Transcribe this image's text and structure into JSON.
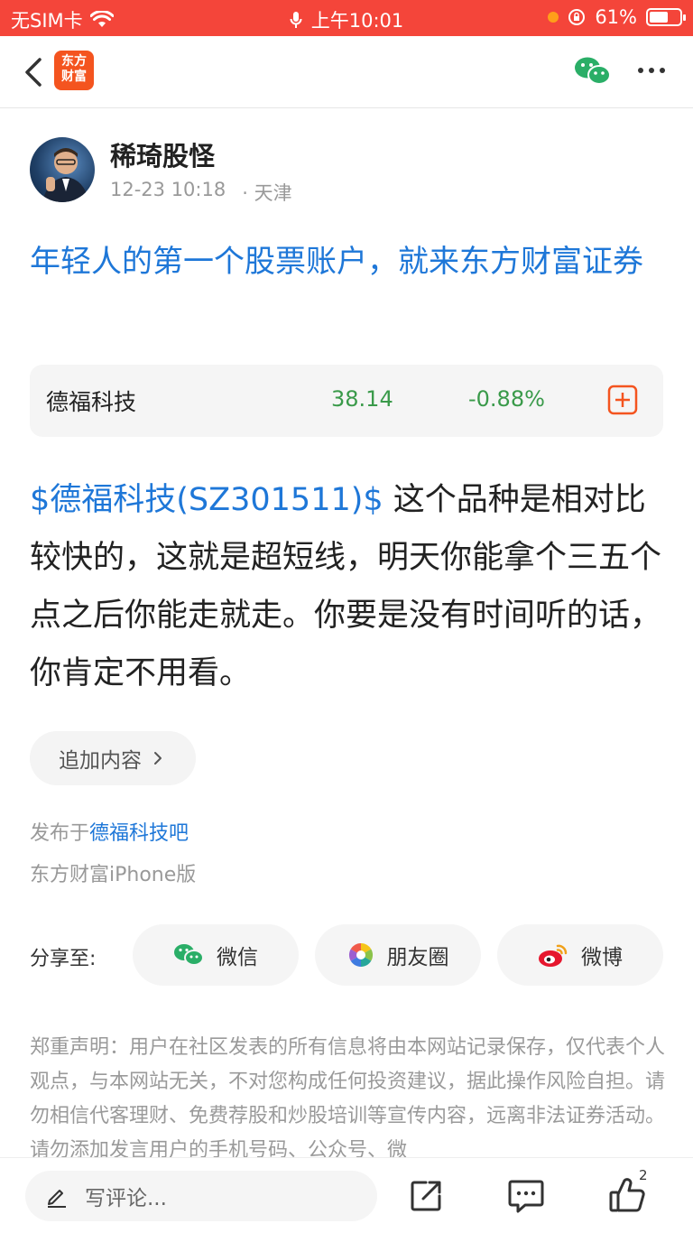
{
  "status_bar": {
    "carrier": "无SIM卡",
    "time": "上午10:01",
    "battery": "61%",
    "battery_level": 0.61
  },
  "nav": {
    "logo_line1": "东方",
    "logo_line2": "财富"
  },
  "author": {
    "name": "稀琦股怪",
    "datetime": "12-23 10:18",
    "location": "· 天津"
  },
  "post": {
    "title": "年轻人的第一个股票账户，就来东方财富证券",
    "stock_card": {
      "name": "德福科技",
      "price": "38.14",
      "change": "-0.88%",
      "change_color": "#3a9a4a"
    },
    "stock_tag": "$德福科技(SZ301511)$",
    "body": " 这个品种是相对比较快的，这就是超短线，明天你能拿个三五个点之后你能走就走。你要是没有时间听的话，你肯定不用看。",
    "add_content_label": "追加内容",
    "published_prefix": "发布于",
    "published_bar": "德福科技吧",
    "client": "东方财富iPhone版"
  },
  "share": {
    "label": "分享至:",
    "wechat": "微信",
    "moments": "朋友圈",
    "weibo": "微博"
  },
  "disclaimer": "郑重声明：用户在社区发表的所有信息将由本网站记录保存，仅代表个人观点，与本网站无关，不对您构成任何投资建议，据此操作风险自担。请勿相信代客理财、免费荐股和炒股培训等宣传内容，远离非法证券活动。请勿添加发言用户的手机号码、公众号、微",
  "bottom_bar": {
    "comment_placeholder": "写评论...",
    "like_count": "2"
  },
  "colors": {
    "status_bar": "#f4453a",
    "link_blue": "#1e77d8",
    "stock_green": "#3a9a4a",
    "brand_orange": "#f4541f"
  }
}
